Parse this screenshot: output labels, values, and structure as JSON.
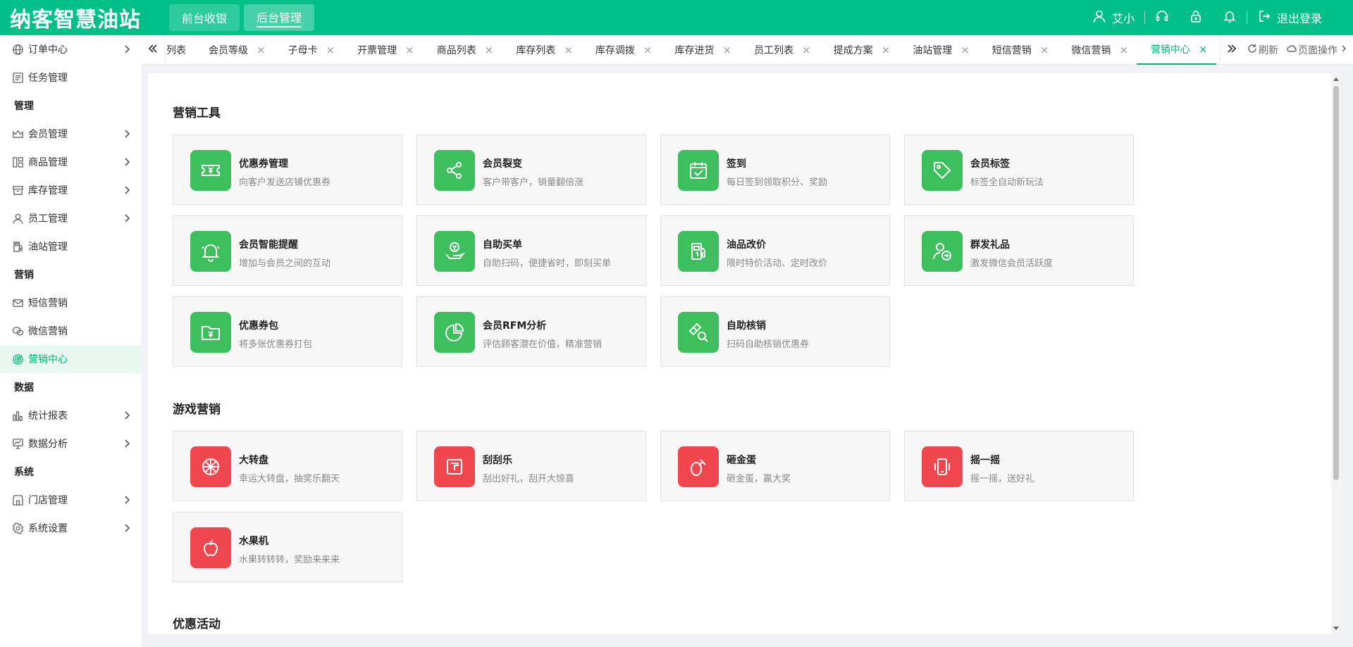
{
  "header": {
    "logo": "纳客智慧油站",
    "tabs": [
      {
        "label": "前台收银",
        "active": false
      },
      {
        "label": "后台管理",
        "active": true
      }
    ],
    "user_name": "艾小",
    "logout_label": "退出登录",
    "brand_color": "#00c087"
  },
  "sidebar": {
    "items": [
      {
        "type": "item",
        "label": "订单中心",
        "icon": "globe-icon",
        "arrow": true
      },
      {
        "type": "item",
        "label": "任务管理",
        "icon": "task-icon",
        "arrow": false
      },
      {
        "type": "group",
        "label": "管理"
      },
      {
        "type": "item",
        "label": "会员管理",
        "icon": "crown-icon",
        "arrow": true
      },
      {
        "type": "item",
        "label": "商品管理",
        "icon": "goods-icon",
        "arrow": true
      },
      {
        "type": "item",
        "label": "库存管理",
        "icon": "inventory-icon",
        "arrow": true
      },
      {
        "type": "item",
        "label": "员工管理",
        "icon": "user-icon",
        "arrow": true
      },
      {
        "type": "item",
        "label": "油站管理",
        "icon": "fuel-pump-icon",
        "arrow": false
      },
      {
        "type": "group",
        "label": "营销"
      },
      {
        "type": "item",
        "label": "短信营销",
        "icon": "mail-icon",
        "arrow": false
      },
      {
        "type": "item",
        "label": "微信营销",
        "icon": "wechat-icon",
        "arrow": false
      },
      {
        "type": "item",
        "label": "营销中心",
        "icon": "target-icon",
        "arrow": false,
        "active": true
      },
      {
        "type": "group",
        "label": "数据"
      },
      {
        "type": "item",
        "label": "统计报表",
        "icon": "bar-chart-icon",
        "arrow": true
      },
      {
        "type": "item",
        "label": "数据分析",
        "icon": "monitor-chart-icon",
        "arrow": true
      },
      {
        "type": "group",
        "label": "系统"
      },
      {
        "type": "item",
        "label": "门店管理",
        "icon": "store-icon",
        "arrow": true
      },
      {
        "type": "item",
        "label": "系统设置",
        "icon": "gear-icon",
        "arrow": true
      }
    ]
  },
  "tabstrip": {
    "tabs": [
      {
        "label": "列表",
        "closable": false
      },
      {
        "label": "会员等级",
        "closable": true
      },
      {
        "label": "子母卡",
        "closable": true
      },
      {
        "label": "开票管理",
        "closable": true
      },
      {
        "label": "商品列表",
        "closable": true
      },
      {
        "label": "库存列表",
        "closable": true
      },
      {
        "label": "库存调拨",
        "closable": true
      },
      {
        "label": "库存进货",
        "closable": true
      },
      {
        "label": "员工列表",
        "closable": true
      },
      {
        "label": "提成方案",
        "closable": true
      },
      {
        "label": "油站管理",
        "closable": true
      },
      {
        "label": "短信营销",
        "closable": true
      },
      {
        "label": "微信营销",
        "closable": true
      },
      {
        "label": "营销中心",
        "closable": true,
        "active": true
      }
    ],
    "close_glyph": "×",
    "refresh_label": "刷新",
    "page_ops_label": "页面操作"
  },
  "sections": [
    {
      "title": "营销工具",
      "color": "#3dbf5d",
      "cards": [
        {
          "title": "优惠券管理",
          "desc": "向客户发送店铺优惠券",
          "icon": "coupon-icon"
        },
        {
          "title": "会员裂变",
          "desc": "客户带客户，销量翻倍涨",
          "icon": "share-icon"
        },
        {
          "title": "签到",
          "desc": "每日签到领取积分、奖励",
          "icon": "calendar-check-icon"
        },
        {
          "title": "会员标签",
          "desc": "标签全自动新玩法",
          "icon": "tag-icon"
        },
        {
          "title": "会员智能提醒",
          "desc": "增加与会员之间的互动",
          "icon": "bell-icon"
        },
        {
          "title": "自助买单",
          "desc": "自助扫码，便捷省时，即刻买单",
          "icon": "hand-coin-icon"
        },
        {
          "title": "油品改价",
          "desc": "限时特价活动、定时改价",
          "icon": "fuel-pump-icon"
        },
        {
          "title": "群发礼品",
          "desc": "激发微信会员活跃度",
          "icon": "user-share-icon"
        },
        {
          "title": "优惠券包",
          "desc": "将多张优惠券打包",
          "icon": "coupon-folder-icon"
        },
        {
          "title": "会员RFM分析",
          "desc": "评估顾客潜在价值，精准营销",
          "icon": "pie-chart-icon"
        },
        {
          "title": "自助核销",
          "desc": "扫码自助核销优惠券",
          "icon": "ticket-search-icon"
        }
      ]
    },
    {
      "title": "游戏营销",
      "color": "#f0474e",
      "cards": [
        {
          "title": "大转盘",
          "desc": "幸运大转盘，抽奖乐翻天",
          "icon": "wheel-icon"
        },
        {
          "title": "刮刮乐",
          "desc": "刮出好礼，刮开大惊喜",
          "icon": "scratch-card-icon"
        },
        {
          "title": "砸金蛋",
          "desc": "砸金蛋，赢大奖",
          "icon": "egg-hammer-icon"
        },
        {
          "title": "摇一摇",
          "desc": "摇一摇，送好礼",
          "icon": "phone-shake-icon"
        },
        {
          "title": "水果机",
          "desc": "水果转转转，奖励来来来",
          "icon": "apple-icon"
        }
      ]
    },
    {
      "title": "优惠活动",
      "cards": []
    }
  ]
}
